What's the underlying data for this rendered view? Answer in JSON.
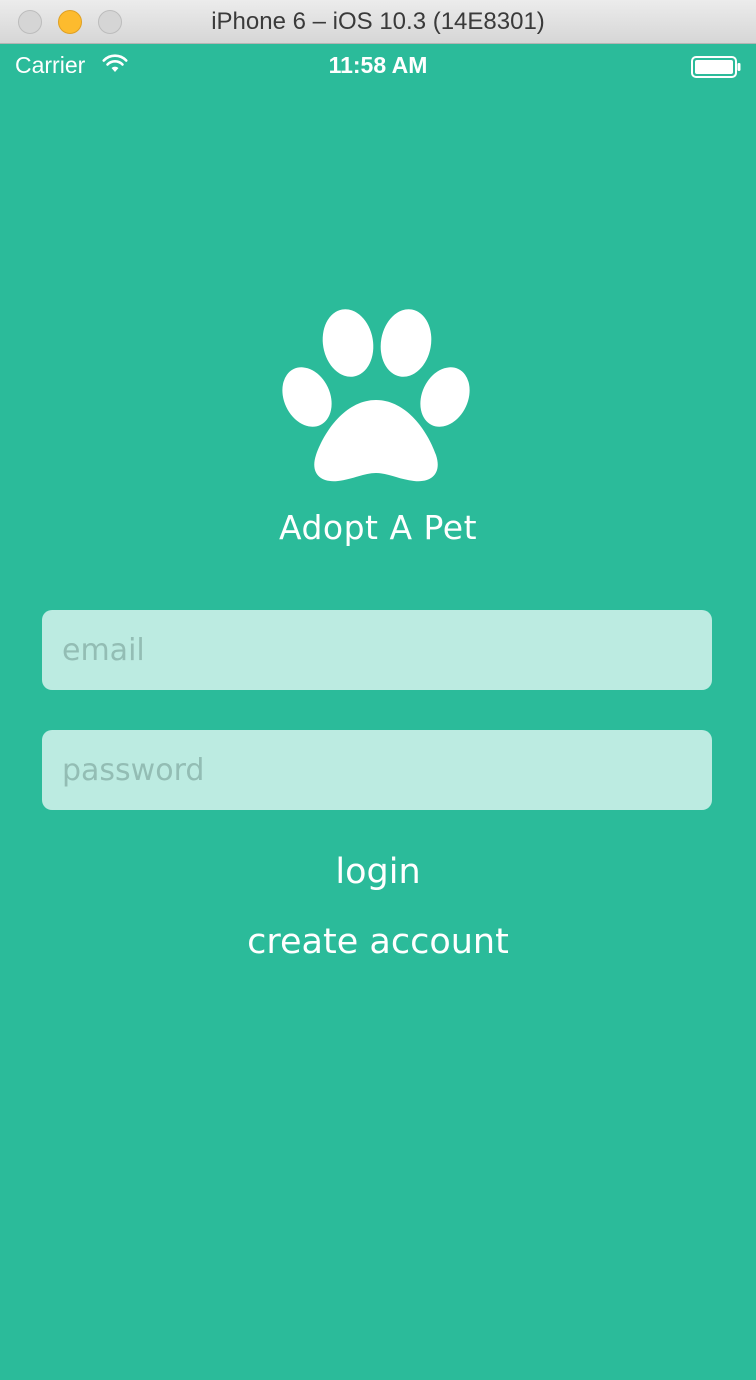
{
  "window": {
    "title": "iPhone 6 – iOS 10.3 (14E8301)"
  },
  "status_bar": {
    "carrier": "Carrier",
    "time": "11:58 AM",
    "wifi_icon": "wifi-icon",
    "battery_icon": "battery-full-icon"
  },
  "app": {
    "logo_icon": "paw-print-icon",
    "title": "Adopt A Pet",
    "email_placeholder": "email",
    "password_placeholder": "password",
    "login_label": "login",
    "create_account_label": "create account"
  },
  "colors": {
    "background": "#2bbb9a",
    "field_background": "#bcebe1",
    "text": "#ffffff",
    "placeholder": "#93bdb4",
    "minimize_button": "#fdbb2e"
  }
}
